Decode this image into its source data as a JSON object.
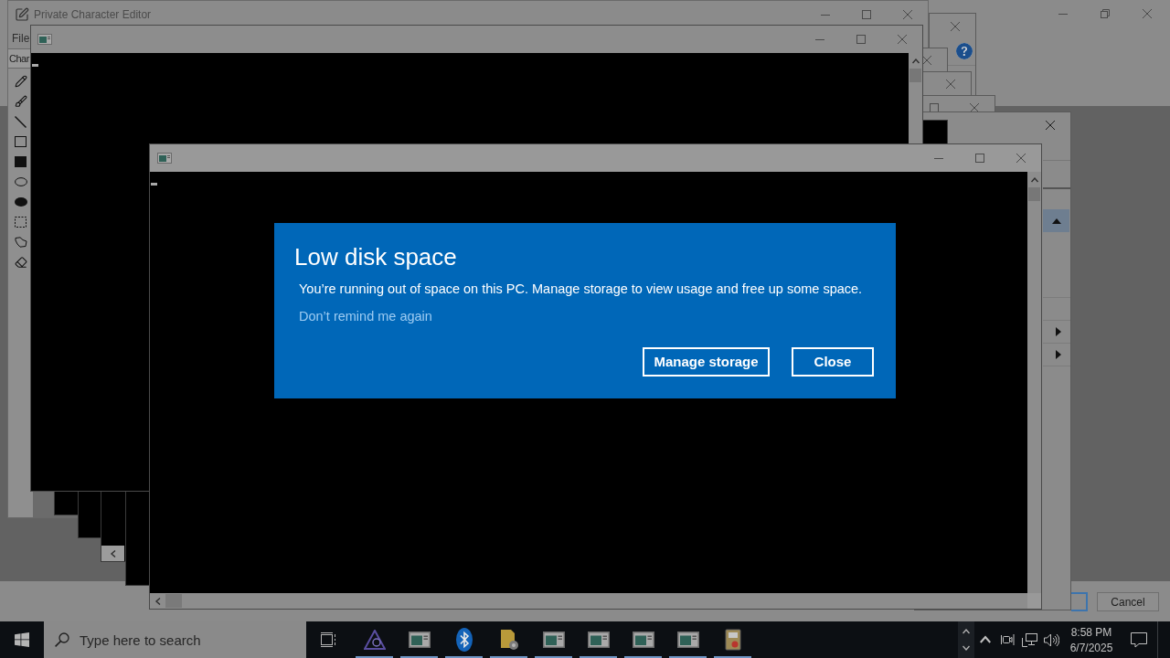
{
  "editor_window": {
    "title": "Private Character Editor",
    "menu": [
      "File"
    ],
    "tab": "Char",
    "tools": [
      {
        "kind": "pencil"
      },
      {
        "kind": "brush"
      },
      {
        "kind": "line"
      },
      {
        "kind": "rectangle"
      },
      {
        "kind": "filled_rectangle"
      },
      {
        "kind": "ellipse"
      },
      {
        "kind": "filled_ellipse"
      },
      {
        "kind": "selection"
      },
      {
        "kind": "freeform"
      },
      {
        "kind": "eraser"
      }
    ]
  },
  "background_window": {
    "buttons": [
      "Cancel"
    ]
  },
  "notification": {
    "title": "Low disk space",
    "message": "You’re running out of space on this PC. Manage storage to view usage and free up some space.",
    "link": "Don’t remind me again",
    "buttons": [
      "Manage storage",
      "Close"
    ]
  },
  "taskbar": {
    "search": {
      "placeholder": "Type here to search"
    },
    "apps": [
      {
        "kind": "triangle",
        "running": true
      },
      {
        "kind": "console",
        "running": true
      },
      {
        "kind": "bluetooth",
        "running": true
      },
      {
        "kind": "document",
        "running": true
      },
      {
        "kind": "console",
        "running": true
      },
      {
        "kind": "console",
        "running": true
      },
      {
        "kind": "console",
        "running": true
      },
      {
        "kind": "console",
        "running": true
      },
      {
        "kind": "package",
        "running": true
      }
    ],
    "clock": {
      "time": "8:58 PM",
      "date": "6/7/2025"
    }
  }
}
